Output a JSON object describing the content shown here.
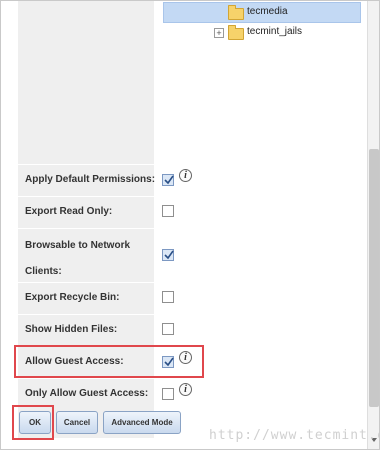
{
  "tree": {
    "items": [
      {
        "label": "tecmedia",
        "selected": true
      },
      {
        "label": "tecmint_jails",
        "expandable": true
      }
    ]
  },
  "rows": [
    {
      "label": "Apply Default Permissions:",
      "checked": true,
      "info": true
    },
    {
      "label": "Export Read Only:",
      "checked": false
    },
    {
      "label": "Browsable to Network Clients:",
      "checked": true
    },
    {
      "label": "Export Recycle Bin:",
      "checked": false
    },
    {
      "label": "Show Hidden Files:",
      "checked": false
    },
    {
      "label": "Allow Guest Access:",
      "checked": true,
      "info": true,
      "highlighted": true
    },
    {
      "label": "Only Allow Guest Access:",
      "checked": false,
      "info": true
    }
  ],
  "buttons": {
    "ok": "OK",
    "cancel": "Cancel",
    "advanced": "Advanced Mode"
  },
  "info_icon": "information-icon",
  "watermark": "http://www.tecmint.com",
  "colors": {
    "highlight": "#e0474c",
    "selection": "#c3d9f4"
  }
}
